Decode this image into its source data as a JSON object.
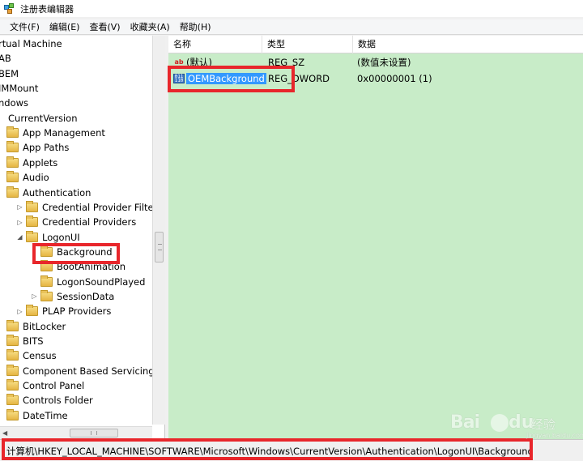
{
  "window": {
    "title": "注册表编辑器"
  },
  "menu": [
    "文件(F)",
    "编辑(E)",
    "查看(V)",
    "收藏夹(A)",
    "帮助(H)"
  ],
  "tree": [
    {
      "label": "rtual Machine",
      "indent": 0,
      "folder": false,
      "expander": ""
    },
    {
      "label": "AB",
      "indent": 0,
      "folder": false,
      "expander": ""
    },
    {
      "label": "BEM",
      "indent": 0,
      "folder": false,
      "expander": ""
    },
    {
      "label": "IMMount",
      "indent": 0,
      "folder": false,
      "expander": ""
    },
    {
      "label": "ndows",
      "indent": 0,
      "folder": false,
      "expander": ""
    },
    {
      "label": "CurrentVersion",
      "indent": 1,
      "folder": false,
      "expander": ""
    },
    {
      "label": "App Management",
      "indent": 2,
      "folder": true,
      "expander": ""
    },
    {
      "label": "App Paths",
      "indent": 2,
      "folder": true,
      "expander": ""
    },
    {
      "label": "Applets",
      "indent": 2,
      "folder": true,
      "expander": ""
    },
    {
      "label": "Audio",
      "indent": 2,
      "folder": true,
      "expander": ""
    },
    {
      "label": "Authentication",
      "indent": 2,
      "folder": true,
      "expander": ""
    },
    {
      "label": "Credential Provider Filters",
      "indent": 3,
      "folder": true,
      "expander": "▷"
    },
    {
      "label": "Credential Providers",
      "indent": 3,
      "folder": true,
      "expander": "▷"
    },
    {
      "label": "LogonUI",
      "indent": 3,
      "folder": true,
      "expander": "◢"
    },
    {
      "label": "Background",
      "indent": 4,
      "folder": true,
      "expander": ""
    },
    {
      "label": "BootAnimation",
      "indent": 4,
      "folder": true,
      "expander": ""
    },
    {
      "label": "LogonSoundPlayed",
      "indent": 4,
      "folder": true,
      "expander": ""
    },
    {
      "label": "SessionData",
      "indent": 4,
      "folder": true,
      "expander": "▷"
    },
    {
      "label": "PLAP Providers",
      "indent": 3,
      "folder": true,
      "expander": "▷"
    },
    {
      "label": "BitLocker",
      "indent": 2,
      "folder": true,
      "expander": ""
    },
    {
      "label": "BITS",
      "indent": 2,
      "folder": true,
      "expander": ""
    },
    {
      "label": "Census",
      "indent": 2,
      "folder": true,
      "expander": ""
    },
    {
      "label": "Component Based Servicing",
      "indent": 2,
      "folder": true,
      "expander": ""
    },
    {
      "label": "Control Panel",
      "indent": 2,
      "folder": true,
      "expander": ""
    },
    {
      "label": "Controls Folder",
      "indent": 2,
      "folder": true,
      "expander": ""
    },
    {
      "label": "DateTime",
      "indent": 2,
      "folder": true,
      "expander": ""
    }
  ],
  "list": {
    "columns": [
      "名称",
      "类型",
      "数据"
    ],
    "rows": [
      {
        "name": "(默认)",
        "type": "REG_SZ",
        "data": "(数值未设置)",
        "icon": "string-value-icon"
      },
      {
        "name": "OEMBackground",
        "type": "REG_DWORD",
        "data": "0x00000001 (1)",
        "icon": "binary-value-icon",
        "selected": true
      }
    ]
  },
  "status": {
    "path": "计算机\\HKEY_LOCAL_MACHINE\\SOFTWARE\\Microsoft\\Windows\\CurrentVersion\\Authentication\\LogonUI\\Background"
  },
  "watermark": {
    "brand_a": "Bai",
    "brand_b": "du",
    "brand_cn": "经验",
    "sub": "jingyan.baidu.com"
  },
  "colors": {
    "list_bg": "#c8ecc8",
    "selection": "#3399ff",
    "highlight": "#e8262b"
  }
}
